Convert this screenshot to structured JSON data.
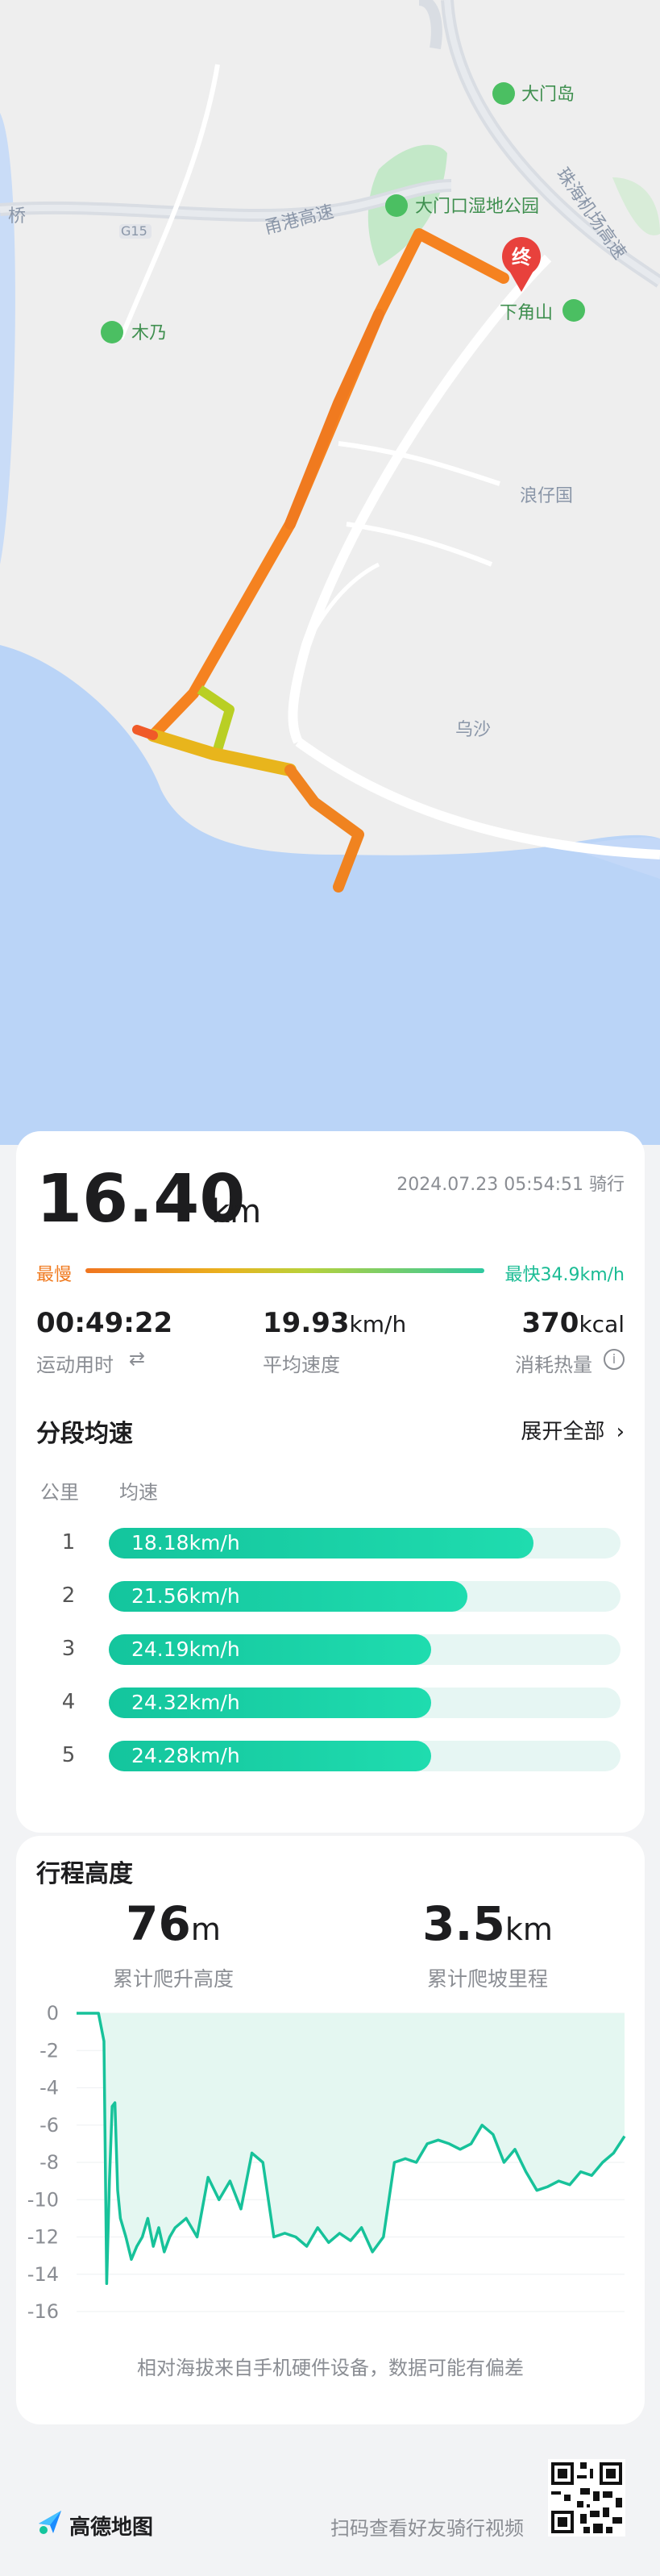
{
  "map": {
    "places": {
      "damendao": "大门岛",
      "wetland_park": "大门口湿地公园",
      "xiajiaoshan": "下角山",
      "munai": "木乃",
      "langzaiguo": "浪仔国",
      "wusha": "乌沙",
      "bridge_fragment": "桥",
      "expressway1": "甬港高速",
      "expressway1_code": "G15",
      "expressway2": "珠海机场高速"
    },
    "end_marker": "终"
  },
  "summary": {
    "distance": "16.40",
    "distance_unit": "km",
    "datetime_type": "2024.07.23 05:54:51 骑行",
    "slowest_label": "最慢",
    "fastest_label": "最快34.9km/h",
    "stats": [
      {
        "value": "00:49:22",
        "unit": "",
        "label": "运动用时"
      },
      {
        "value": "19.93",
        "unit": "km/h",
        "label": "平均速度"
      },
      {
        "value": "370",
        "unit": "kcal",
        "label": "消耗热量"
      }
    ]
  },
  "segments": {
    "title": "分段均速",
    "expand_label": "展开全部",
    "col_km": "公里",
    "col_speed": "均速",
    "rows": [
      {
        "km": "1",
        "speed": "18.18km/h",
        "ratio": 0.83
      },
      {
        "km": "2",
        "speed": "21.56km/h",
        "ratio": 0.7
      },
      {
        "km": "3",
        "speed": "24.19km/h",
        "ratio": 0.63
      },
      {
        "km": "4",
        "speed": "24.32km/h",
        "ratio": 0.63
      },
      {
        "km": "5",
        "speed": "24.28km/h",
        "ratio": 0.63
      }
    ]
  },
  "elevation": {
    "title": "行程高度",
    "climb_value": "76",
    "climb_unit": "m",
    "climb_label": "累计爬升高度",
    "slope_value": "3.5",
    "slope_unit": "km",
    "slope_label": "累计爬坡里程",
    "note": "相对海拔来自手机硬件设备，数据可能有偏差",
    "chart_data": {
      "type": "area",
      "yticks": [
        "0",
        "-2",
        "-4",
        "-6",
        "-8",
        "-10",
        "-12",
        "-14",
        "-16"
      ],
      "ylim": [
        -16,
        0
      ],
      "xlabel": "",
      "ylabel": "",
      "color": "#17c29a",
      "x": [
        0,
        2,
        4,
        5,
        5.5,
        6,
        6.5,
        7,
        7.5,
        8,
        9,
        10,
        11,
        12,
        13,
        14,
        15,
        16,
        17,
        18,
        20,
        22,
        24,
        26,
        28,
        30,
        32,
        34,
        36,
        38,
        40,
        42,
        44,
        46,
        48,
        50,
        52,
        54,
        56,
        58,
        60,
        62,
        64,
        66,
        68,
        70,
        72,
        74,
        76,
        78,
        80,
        82,
        84,
        86,
        88,
        90,
        92,
        94,
        96,
        98,
        100
      ],
      "values": [
        0,
        0,
        0,
        -1.5,
        -14.5,
        -9,
        -5,
        -4.8,
        -9.5,
        -11,
        -12,
        -13.2,
        -12.5,
        -12,
        -11,
        -12.5,
        -11.5,
        -12.8,
        -12,
        -11.5,
        -11,
        -12,
        -8.8,
        -10,
        -9,
        -10.5,
        -7.5,
        -8,
        -12,
        -11.8,
        -12,
        -12.5,
        -11.5,
        -12.3,
        -11.8,
        -12.2,
        -11.5,
        -12.8,
        -12,
        -8,
        -7.8,
        -8,
        -7,
        -6.8,
        -7,
        -7.3,
        -7,
        -6,
        -6.5,
        -8,
        -7.3,
        -8.5,
        -9.5,
        -9.3,
        -9,
        -9.2,
        -8.5,
        -8.7,
        -8,
        -7.5,
        -6.6
      ]
    }
  },
  "footer": {
    "brand": "高德地图",
    "scan_text": "扫码查看好友骑行视频"
  },
  "colors": {
    "accent_green": "#17c29a",
    "route_orange": "#f07a1f",
    "slow_orange": "#f07a1f"
  }
}
